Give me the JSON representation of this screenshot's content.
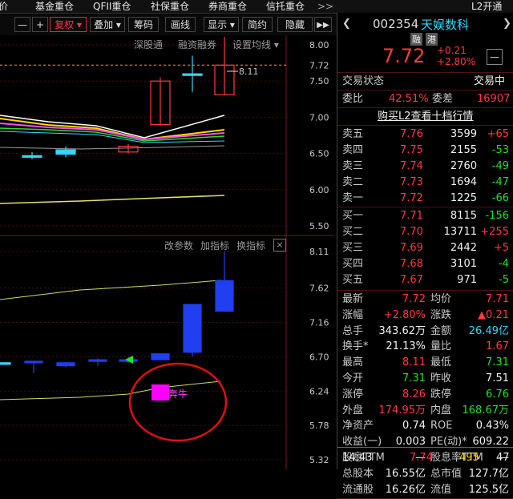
{
  "top_menu": {
    "items": [
      "评价",
      "基金重仓",
      "QFII重仓",
      "社保重仓",
      "券商重仓",
      "信托重仓"
    ],
    "more": ">>",
    "l2_open": "L2开通"
  },
  "toolbar": {
    "minus": "—",
    "plus": "+",
    "fuquan": "复权",
    "dieija": "叠加",
    "choumai": "筹码",
    "huaxian": "画线",
    "xianshi": "显示",
    "jianyue": "简约",
    "yincang": "隐藏"
  },
  "chart_links": {
    "shenguitong": "深股通",
    "rongzi": "融资融券",
    "set_ma": "设置均线",
    "change_param": "改参数",
    "add_indicator": "加指标",
    "switch_indicator": "换指标",
    "close": "×",
    "hi_label": "8.11",
    "pattern_label": "奔牛"
  },
  "chart_data": [
    {
      "type": "candlestick",
      "y_ticks": [
        "8.00",
        "7.72",
        "7.50",
        "7.00",
        "6.50",
        "6.00",
        "5.50"
      ],
      "current_price_marker": 7.72,
      "high_label": 8.11,
      "candles": [
        {
          "o": 6.47,
          "c": 6.47,
          "h": 6.52,
          "l": 6.42,
          "color": "cyan"
        },
        {
          "o": 6.55,
          "c": 6.49,
          "h": 6.6,
          "l": 6.45,
          "color": "cyan"
        },
        {
          "o": 6.52,
          "c": 6.6,
          "h": 6.63,
          "l": 6.5,
          "color": "red"
        },
        {
          "o": 6.9,
          "c": 7.5,
          "h": 7.55,
          "l": 6.88,
          "color": "red"
        },
        {
          "o": 7.6,
          "c": 7.6,
          "h": 7.85,
          "l": 7.35,
          "color": "cyan"
        },
        {
          "o": 7.31,
          "c": 7.72,
          "h": 8.11,
          "l": 7.31,
          "color": "red"
        }
      ],
      "ma_lines": [
        "white",
        "yellow",
        "magenta",
        "green",
        "cyan",
        "gray"
      ]
    },
    {
      "type": "candlestick",
      "y_ticks": [
        "8.11",
        "7.62",
        "7.16",
        "6.70",
        "6.24",
        "5.78",
        "5.32"
      ],
      "candles": [
        {
          "o": 6.62,
          "c": 6.62,
          "h": 6.62,
          "l": 6.62,
          "color": "cyan"
        },
        {
          "o": 6.64,
          "c": 6.62,
          "h": 6.64,
          "l": 6.48,
          "color": "blue"
        },
        {
          "o": 6.62,
          "c": 6.58,
          "h": 6.63,
          "l": 6.56,
          "color": "blue"
        },
        {
          "o": 6.66,
          "c": 6.64,
          "h": 6.68,
          "l": 6.58,
          "color": "blue"
        },
        {
          "o": 6.66,
          "c": 6.66,
          "h": 6.7,
          "l": 6.62,
          "color": "blue"
        },
        {
          "o": 6.74,
          "c": 6.66,
          "h": 6.74,
          "l": 6.66,
          "color": "blue"
        },
        {
          "o": 7.4,
          "c": 6.76,
          "h": 7.4,
          "l": 6.7,
          "color": "blue"
        },
        {
          "o": 7.6,
          "c": 7.6,
          "h": 7.8,
          "l": 7.3,
          "color": "blue"
        },
        {
          "o": 7.72,
          "c": 7.31,
          "h": 8.11,
          "l": 7.31,
          "color": "blue"
        }
      ]
    }
  ],
  "stock": {
    "code": "002354",
    "name": "天娱数科",
    "tag_rong": "融",
    "tag_gang": "港",
    "price": "7.72",
    "change": "+0.21",
    "change_pct": "+2.80%",
    "minus_btn": "—"
  },
  "status": {
    "label": "交易状态",
    "value": "交易中"
  },
  "weibi": {
    "label": "委比",
    "value": "42.51%",
    "wc_label": "委差",
    "wc_value": "16907"
  },
  "l2_link": "购买L2查看十档行情",
  "sell": [
    {
      "label": "卖五",
      "price": "7.76",
      "vol": "3599",
      "chg": "+65",
      "chg_color": "red"
    },
    {
      "label": "卖四",
      "price": "7.75",
      "vol": "2155",
      "chg": "-53",
      "chg_color": "green"
    },
    {
      "label": "卖三",
      "price": "7.74",
      "vol": "2760",
      "chg": "-49",
      "chg_color": "green"
    },
    {
      "label": "卖二",
      "price": "7.73",
      "vol": "1694",
      "chg": "-47",
      "chg_color": "green"
    },
    {
      "label": "卖一",
      "price": "7.72",
      "vol": "1225",
      "chg": "-66",
      "chg_color": "green"
    }
  ],
  "buy": [
    {
      "label": "买一",
      "price": "7.71",
      "vol": "8115",
      "chg": "-156",
      "chg_color": "green"
    },
    {
      "label": "买二",
      "price": "7.70",
      "vol": "13711",
      "chg": "+255",
      "chg_color": "red"
    },
    {
      "label": "买三",
      "price": "7.69",
      "vol": "2442",
      "chg": "+5",
      "chg_color": "red"
    },
    {
      "label": "买四",
      "price": "7.68",
      "vol": "3101",
      "chg": "-4",
      "chg_color": "green"
    },
    {
      "label": "买五",
      "price": "7.67",
      "vol": "971",
      "chg": "-5",
      "chg_color": "green"
    }
  ],
  "stats": [
    {
      "l1": "最新",
      "v1": "7.72",
      "c1": "red",
      "l2": "均价",
      "v2": "7.71",
      "c2": "red"
    },
    {
      "l1": "涨幅",
      "v1": "+2.80%",
      "c1": "red",
      "l2": "涨跌",
      "v2": "▲0.21",
      "c2": "red"
    },
    {
      "l1": "总手",
      "v1": "343.62万",
      "c1": "white",
      "l2": "金额",
      "v2": "26.49亿",
      "c2": "cyan"
    },
    {
      "l1": "换手*",
      "v1": "21.13%",
      "c1": "white",
      "l2": "量比",
      "v2": "1.67",
      "c2": "red"
    },
    {
      "l1": "最高",
      "v1": "8.11",
      "c1": "red",
      "l2": "最低",
      "v2": "7.31",
      "c2": "green"
    },
    {
      "l1": "今开",
      "v1": "7.31",
      "c1": "green",
      "l2": "昨收",
      "v2": "7.51",
      "c2": "white"
    },
    {
      "l1": "涨停",
      "v1": "8.26",
      "c1": "red",
      "l2": "跌停",
      "v2": "6.76",
      "c2": "green"
    },
    {
      "l1": "外盘",
      "v1": "174.95万",
      "c1": "red",
      "l2": "内盘",
      "v2": "168.67万",
      "c2": "green"
    },
    {
      "l1": "净资产",
      "v1": "0.74",
      "c1": "white",
      "l2": "ROE",
      "v2": "0.43%",
      "c2": "white"
    },
    {
      "l1": "收益(一)",
      "v1": "0.003",
      "c1": "white",
      "l2": "PE(动)*",
      "v2": "609.22",
      "c2": "white"
    },
    {
      "l1": "股息TTM",
      "v1": "—",
      "c1": "white",
      "l2": "股息率TTM",
      "v2": "—",
      "c2": "white"
    },
    {
      "l1": "总股本",
      "v1": "16.55亿",
      "c1": "white",
      "l2": "总市值",
      "v2": "127.7亿",
      "c2": "white"
    },
    {
      "l1": "流通股",
      "v1": "16.26亿",
      "c1": "white",
      "l2": "流值",
      "v2": "125.5亿",
      "c2": "white"
    }
  ],
  "trade_tick": {
    "time": "14:43",
    "price": "7.74",
    "vol": "495",
    "count": "47"
  },
  "colors": {
    "red": "#ff3b3b",
    "green": "#27e027",
    "cyan": "#36d7ff",
    "blue": "#1f3ff0",
    "magenta": "#ff00ff",
    "yellow": "#ffd700"
  }
}
